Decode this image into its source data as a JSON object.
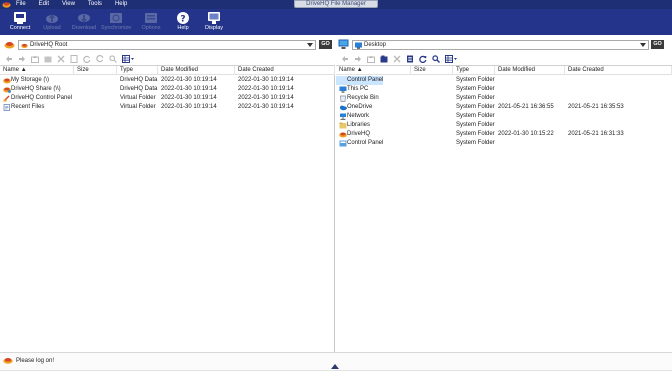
{
  "window": {
    "title": "DriveHQ File Manager"
  },
  "menu": [
    "File",
    "Edit",
    "View",
    "Tools",
    "Help"
  ],
  "ribbon": [
    {
      "label": "Connect",
      "icon": "connect-icon",
      "enabled": true
    },
    {
      "label": "Upload",
      "icon": "upload-icon",
      "enabled": false
    },
    {
      "label": "Download",
      "icon": "download-icon",
      "enabled": false
    },
    {
      "label": "Synchronize",
      "icon": "synchronize-icon",
      "enabled": false
    },
    {
      "label": "Options",
      "icon": "options-icon",
      "enabled": false
    },
    {
      "label": "Help",
      "icon": "help-icon",
      "enabled": true
    },
    {
      "label": "Display",
      "icon": "display-icon",
      "enabled": true
    }
  ],
  "left": {
    "location": "DriveHQ Root",
    "go": "GO",
    "columns": [
      "Name",
      "Size",
      "Type",
      "Date Modified",
      "Date Created"
    ],
    "rows": [
      {
        "name": "My Storage (\\)",
        "size": "",
        "type": "DriveHQ Data",
        "modified": "2022-01-30 10:19:14",
        "created": "2022-01-30 10:19:14",
        "icon": "storage-icon"
      },
      {
        "name": "DriveHQ Share (\\\\)",
        "size": "",
        "type": "DriveHQ Data",
        "modified": "2022-01-30 10:19:14",
        "created": "2022-01-30 10:19:14",
        "icon": "share-icon"
      },
      {
        "name": "DriveHQ Control Panel",
        "size": "",
        "type": "Virtual Folder",
        "modified": "2022-01-30 10:19:14",
        "created": "2022-01-30 10:19:14",
        "icon": "control-panel-icon"
      },
      {
        "name": "Recent Files",
        "size": "",
        "type": "Virtual Folder",
        "modified": "2022-01-30 10:19:14",
        "created": "2022-01-30 10:19:14",
        "icon": "recent-files-icon"
      }
    ]
  },
  "right": {
    "location": "Desktop",
    "go": "GO",
    "columns": [
      "Name",
      "Size",
      "Type",
      "Date Modified",
      "Date Created"
    ],
    "rows": [
      {
        "name": "Control Panel",
        "size": "",
        "type": "System Folder",
        "modified": "",
        "created": "",
        "icon": "control-panel-icon",
        "selected": true
      },
      {
        "name": "This PC",
        "size": "",
        "type": "System Folder",
        "modified": "",
        "created": "",
        "icon": "computer-icon"
      },
      {
        "name": "Recycle Bin",
        "size": "",
        "type": "System Folder",
        "modified": "",
        "created": "",
        "icon": "recycle-bin-icon"
      },
      {
        "name": "OneDrive",
        "size": "",
        "type": "System Folder",
        "modified": "2021-05-21 16:36:55",
        "created": "2021-05-21 16:35:53",
        "icon": "onedrive-icon"
      },
      {
        "name": "Network",
        "size": "",
        "type": "System Folder",
        "modified": "",
        "created": "",
        "icon": "network-icon"
      },
      {
        "name": "Libraries",
        "size": "",
        "type": "System Folder",
        "modified": "",
        "created": "",
        "icon": "libraries-icon"
      },
      {
        "name": "DriveHQ",
        "size": "",
        "type": "System Folder",
        "modified": "2022-01-30 10:15:22",
        "created": "2021-05-21 16:31:33",
        "icon": "drivehq-icon"
      },
      {
        "name": "Control Panel",
        "size": "",
        "type": "System Folder",
        "modified": "",
        "created": "",
        "icon": "control-panel-icon"
      }
    ]
  },
  "status": {
    "text": "Please log on!"
  },
  "colors": {
    "ribbon": "#24348a",
    "titlebar": "#1f2f76",
    "selection": "#cce5ff"
  }
}
